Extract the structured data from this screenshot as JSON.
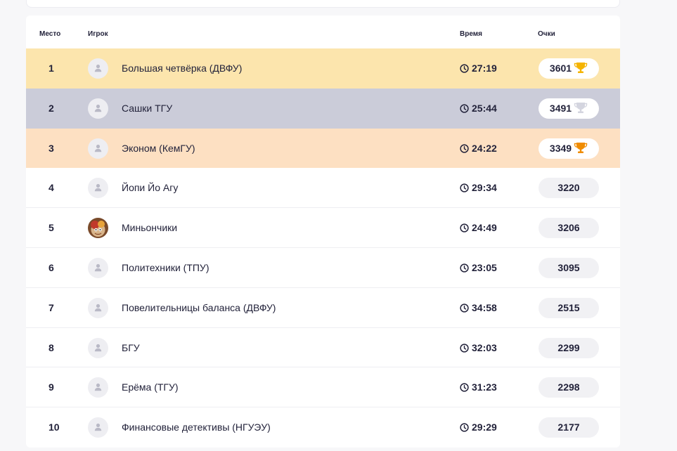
{
  "table": {
    "headers": {
      "place": "Место",
      "player": "Игрок",
      "time": "Время",
      "score": "Очки"
    },
    "rows": [
      {
        "place": "1",
        "name": "Большая четвёрка (ДВФУ)",
        "time": "27:19",
        "score": "3601",
        "trophy": "gold",
        "avatar": "default"
      },
      {
        "place": "2",
        "name": "Сашки ТГУ",
        "time": "25:44",
        "score": "3491",
        "trophy": "silver",
        "avatar": "default"
      },
      {
        "place": "3",
        "name": "Эконом (КемГУ)",
        "time": "24:22",
        "score": "3349",
        "trophy": "bronze",
        "avatar": "default"
      },
      {
        "place": "4",
        "name": "Йопи Йо Агу",
        "time": "29:34",
        "score": "3220",
        "trophy": "",
        "avatar": "default"
      },
      {
        "place": "5",
        "name": "Миньончики",
        "time": "24:49",
        "score": "3206",
        "trophy": "",
        "avatar": "photo"
      },
      {
        "place": "6",
        "name": "Политехники (ТПУ)",
        "time": "23:05",
        "score": "3095",
        "trophy": "",
        "avatar": "default"
      },
      {
        "place": "7",
        "name": "Повелительницы баланса (ДВФУ)",
        "time": "34:58",
        "score": "2515",
        "trophy": "",
        "avatar": "default"
      },
      {
        "place": "8",
        "name": "БГУ",
        "time": "32:03",
        "score": "2299",
        "trophy": "",
        "avatar": "default"
      },
      {
        "place": "9",
        "name": "Ерёма (ТГУ)",
        "time": "31:23",
        "score": "2298",
        "trophy": "",
        "avatar": "default"
      },
      {
        "place": "10",
        "name": "Финансовые детективы (НГУЭУ)",
        "time": "29:29",
        "score": "2177",
        "trophy": "",
        "avatar": "default"
      }
    ]
  },
  "colors": {
    "gold_row": "#fce5ad",
    "silver_row": "#cbccd9",
    "bronze_row": "#fde0c2",
    "gold_trophy": "#f5b400",
    "silver_trophy": "#d4d5df",
    "bronze_trophy": "#f08c00"
  },
  "icons": {
    "avatar": "user-silhouette-icon",
    "time": "clock-icon",
    "trophy": "trophy-icon"
  }
}
